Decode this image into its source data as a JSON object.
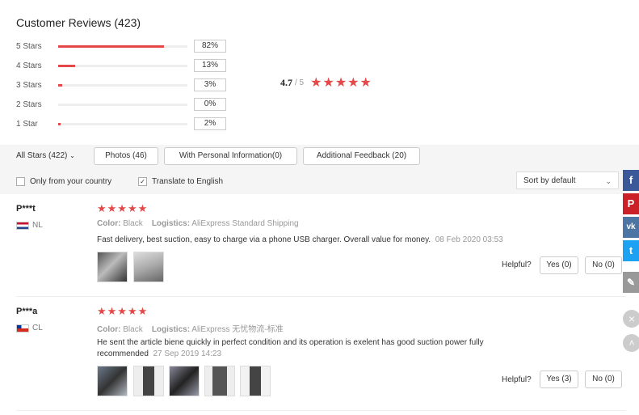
{
  "header": {
    "title": "Customer Reviews (423)"
  },
  "distribution": [
    {
      "label": "5 Stars",
      "pct": "82%",
      "fraction": 0.82
    },
    {
      "label": "4 Stars",
      "pct": "13%",
      "fraction": 0.13
    },
    {
      "label": "3 Stars",
      "pct": "3%",
      "fraction": 0.03
    },
    {
      "label": "2 Stars",
      "pct": "0%",
      "fraction": 0.0
    },
    {
      "label": "1 Star",
      "pct": "2%",
      "fraction": 0.02
    }
  ],
  "average": {
    "value": "4.7",
    "out_of": "/ 5",
    "stars": "★★★★★"
  },
  "filters": {
    "all": "All Stars (422)",
    "chips": [
      "Photos (46)",
      "With Personal Information(0)",
      "Additional Feedback (20)"
    ],
    "only_country": "Only from your country",
    "translate": "Translate to English",
    "translate_checked": "✓",
    "sort": "Sort by default"
  },
  "reviews": [
    {
      "name": "P***t",
      "country": "NL",
      "stars": "★★★★★",
      "color_label": "Color:",
      "color_value": "Black",
      "logistics_label": "Logistics:",
      "logistics_value": "AliExpress Standard Shipping",
      "text": "Fast delivery, best suction, easy to charge via a phone USB charger. Overall value for money.",
      "date": "08 Feb 2020 03:53",
      "helpful": "Helpful?",
      "yes": "Yes (0)",
      "no": "No (0)"
    },
    {
      "name": "P***a",
      "country": "CL",
      "stars": "★★★★★",
      "color_label": "Color:",
      "color_value": "Black",
      "logistics_label": "Logistics:",
      "logistics_value": "AliExpress 无忧物流-标准",
      "text": "He sent the article biene quickly in perfect condition and its operation is exelent has good suction power fully recommended",
      "date": "27 Sep 2019 14:23",
      "helpful": "Helpful?",
      "yes": "Yes (3)",
      "no": "No (0)"
    }
  ],
  "colors": {
    "accent": "#e54848",
    "facebook": "#3b5998",
    "pinterest": "#cb2027",
    "vk": "#4c75a3",
    "twitter": "#1da1f2",
    "edit": "#999999"
  },
  "icons": {
    "facebook": "facebook-icon",
    "pinterest": "pinterest-icon",
    "vk": "vk-icon",
    "twitter": "twitter-icon",
    "edit": "pencil-icon",
    "close": "close-icon",
    "up": "chevron-up-icon"
  }
}
